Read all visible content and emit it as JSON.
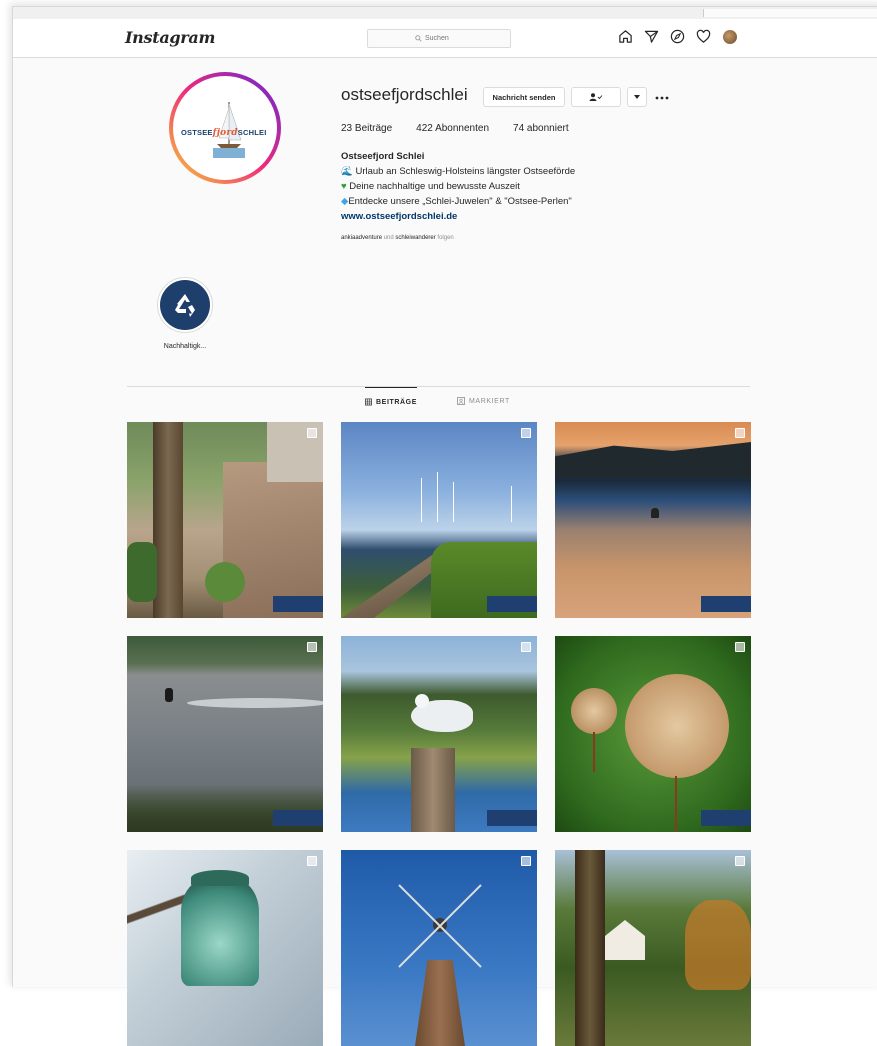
{
  "header": {
    "logo": "Instagram",
    "search_placeholder": "Suchen",
    "nav_icons": [
      "home-icon",
      "direct-icon",
      "explore-icon",
      "heart-icon",
      "profile-avatar"
    ]
  },
  "profile": {
    "username": "ostseefjordschlei",
    "message_button": "Nachricht senden",
    "profile_pic_text_a": "OSTSEE",
    "profile_pic_text_b": "fjord",
    "profile_pic_text_c": "SCHLEI",
    "stats": {
      "posts": "23 Beiträge",
      "followers": "422 Abonnenten",
      "following": "74 abonniert"
    },
    "bio": {
      "name": "Ostseefjord Schlei",
      "line1": "Urlaub an Schleswig-Holsteins längster Ostseeförde",
      "line2": "Deine nachhaltige und bewusste Auszeit",
      "line3": "Entdecke unsere „Schlei-Juwelen\" & \"Ostsee-Perlen\"",
      "website": "www.ostseefjordschlei.de"
    },
    "followed_by": {
      "user1": "ankiaadventure",
      "und": "und",
      "user2": "schleiwanderer",
      "suffix": "folgen"
    }
  },
  "highlights": [
    {
      "label": "Nachhaltigk..."
    }
  ],
  "tabs": {
    "posts": "BEITRÄGE",
    "tagged": "MARKIERT"
  },
  "colors": {
    "brand_blue": "#1f3f70",
    "link": "#00376b"
  }
}
